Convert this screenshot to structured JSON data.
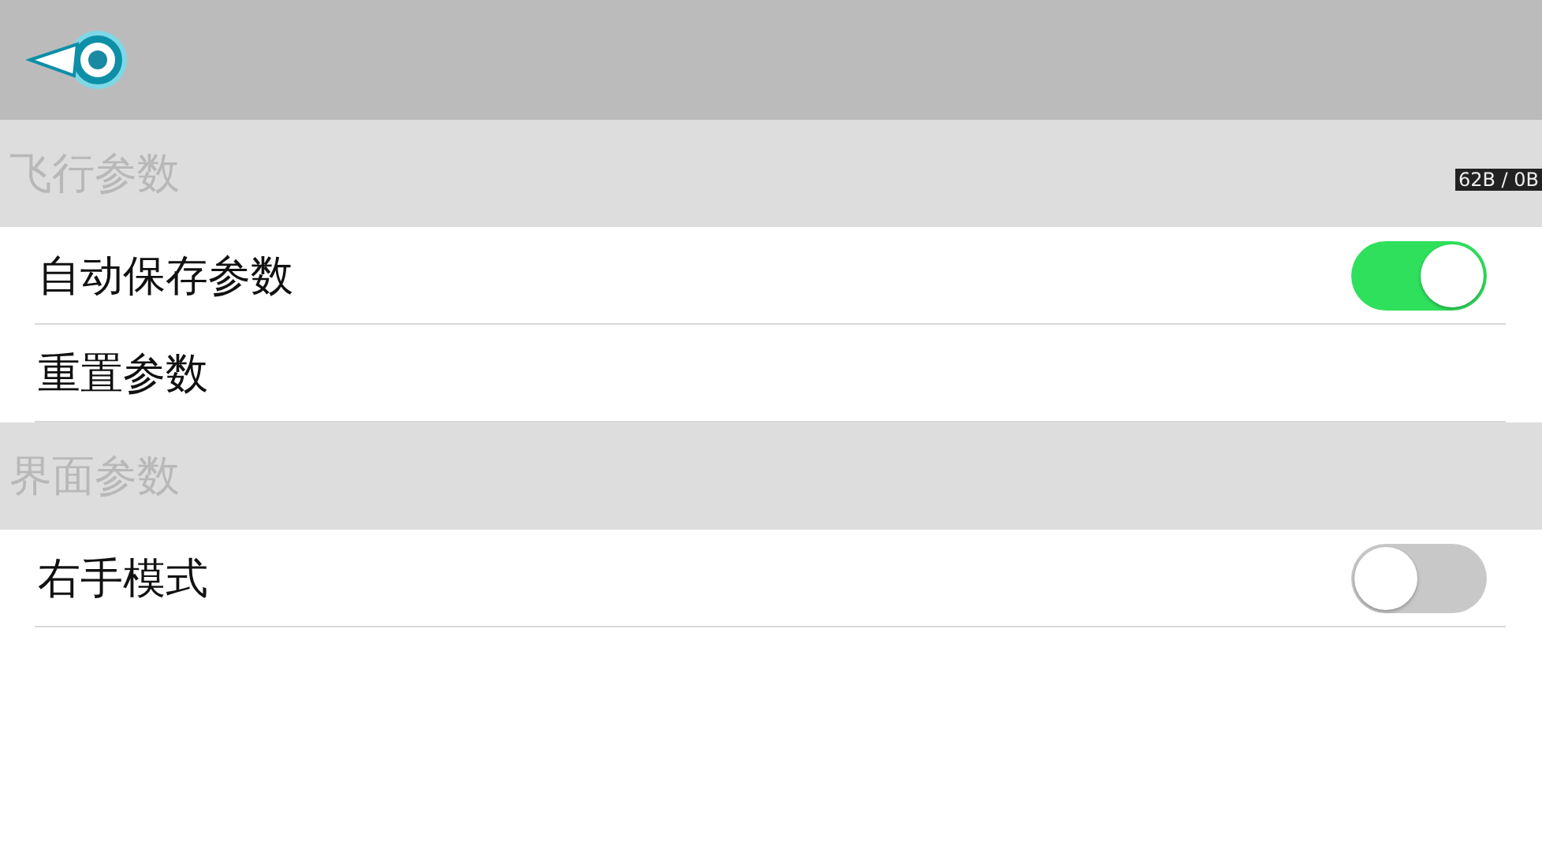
{
  "traffic_badge": "62B / 0B",
  "sections": [
    {
      "title": "飞行参数",
      "items": [
        {
          "kind": "toggle",
          "label": "自动保存参数",
          "on": true
        },
        {
          "kind": "action",
          "label": "重置参数"
        }
      ]
    },
    {
      "title": "界面参数",
      "items": [
        {
          "kind": "toggle",
          "label": "右手模式",
          "on": false
        }
      ]
    }
  ]
}
